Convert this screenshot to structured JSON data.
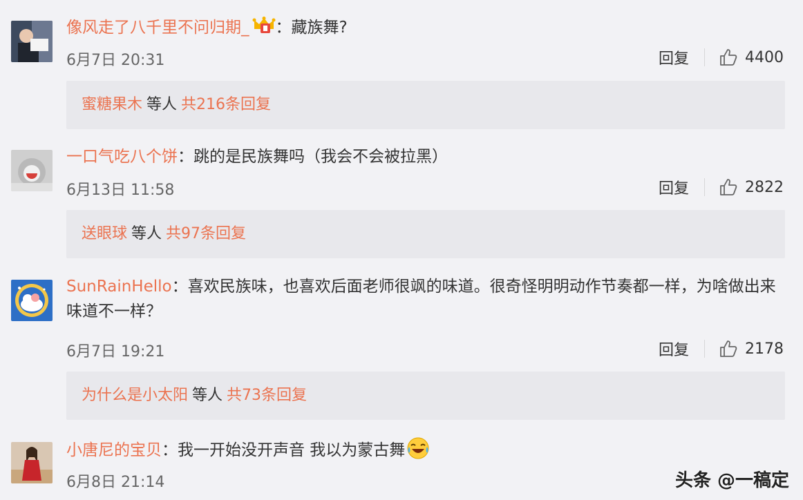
{
  "comments": [
    {
      "username": "像风走了八千里不问归期_",
      "colon": "：",
      "text": "藏族舞?",
      "time": "6月7日 20:31",
      "reply": "回复",
      "likes": "4400",
      "sub": {
        "user": "蜜糖果木",
        "mid": "等人",
        "total": "共216条回复"
      }
    },
    {
      "username": "一口气吃八个饼",
      "colon": "：",
      "text": "跳的是民族舞吗（我会不会被拉黑）",
      "time": "6月13日 11:58",
      "reply": "回复",
      "likes": "2822",
      "sub": {
        "user": "送眼球",
        "mid": "等人",
        "total": "共97条回复"
      }
    },
    {
      "username": "SunRainHello",
      "colon": "：",
      "text": "喜欢民族味，也喜欢后面老师很飒的味道。很奇怪明明动作节奏都一样，为啥做出来味道不一样？",
      "time": "6月7日 19:21",
      "reply": "回复",
      "likes": "2178",
      "sub": {
        "user": "为什么是小太阳",
        "mid": "等人",
        "total": "共73条回复"
      }
    },
    {
      "username": "小唐尼的宝贝",
      "colon": "：",
      "text": "我一开始没开声音 我以为蒙古舞",
      "time": "6月8日 21:14"
    }
  ],
  "watermark": "头条 @一稿定",
  "colors": {
    "username": "#eb7350",
    "background": "#f2f2f5",
    "subbox": "#e8e8ec"
  },
  "icons": [
    "thumbs-up-icon",
    "vip-crown-badge-icon",
    "laugh-cry-emoji-icon"
  ]
}
